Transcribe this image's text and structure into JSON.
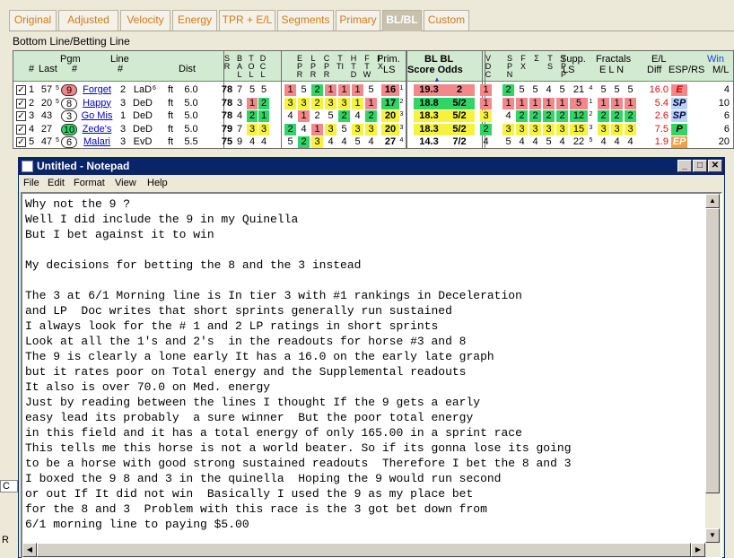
{
  "tabs": [
    "Original",
    "Adjusted",
    "Velocity",
    "Energy",
    "TPR + E/L",
    "Segments",
    "Primary",
    "BL/BL",
    "Custom"
  ],
  "section_title": "Bottom Line/Betting Line",
  "grid": {
    "headers": {
      "num": "#",
      "last": "Last",
      "pgm": "Pgm",
      "pgm_num": "#",
      "line": "Line",
      "line_num": "#",
      "dist": "Dist",
      "prim": "Prim.",
      "ls": "LS",
      "bl_bl": "BL BL",
      "score_odds": "Score Odds",
      "supp": "Supp.",
      "fractals": "Fractals",
      "eln": "E L N",
      "el": "E/L",
      "diff": "Diff",
      "esp": "ESP/RS",
      "win": "Win",
      "ml": "M/L",
      "vertical": [
        {
          "text": "SR"
        },
        {
          "text": "BAL"
        },
        {
          "text": "TOL"
        },
        {
          "text": "DCL"
        },
        {
          "text": "EPR"
        },
        {
          "text": "LPR"
        },
        {
          "text": "CPR"
        },
        {
          "text": "TTI"
        },
        {
          "text": "HTD"
        },
        {
          "text": "FTW"
        },
        {
          "text": "FX"
        },
        {
          "text": "VDC"
        },
        {
          "text": "SPN"
        },
        {
          "text": "FX"
        },
        {
          "text": "Σ"
        },
        {
          "text": "TS"
        },
        {
          "text": "TPP"
        }
      ]
    },
    "rows": [
      {
        "checked": "✓",
        "num": "1",
        "last": "57",
        "last_sup": "5",
        "pgm": "9",
        "name": "Forget",
        "line_num": "2",
        "line": "LaD",
        "line_sup": "6",
        "surf": "ft",
        "dist": "6.0",
        "sr": "78",
        "a": "7",
        "b": "5",
        "c": "5",
        "pr": [
          {
            "v": "1",
            "k": "r"
          },
          {
            "v": "5",
            "k": ""
          },
          {
            "v": "2",
            "k": "g"
          },
          {
            "v": "1",
            "k": "r"
          },
          {
            "v": "1",
            "k": "r"
          },
          {
            "v": "1",
            "k": "r"
          },
          {
            "v": "5",
            "k": ""
          }
        ],
        "prim": "16",
        "prim_sup": "1",
        "prim_k": "r",
        "score": "19.3",
        "odds": "2",
        "bl_k": "r",
        "vdc": "1",
        "vdc_k": "r",
        "sp": [
          {
            "v": "2",
            "k": "g"
          },
          {
            "v": "5",
            "k": ""
          },
          {
            "v": "5",
            "k": ""
          },
          {
            "v": "4",
            "k": ""
          },
          {
            "v": "5",
            "k": ""
          }
        ],
        "supp": "21",
        "supp_sup": "4",
        "supp_k": "",
        "fr": [
          {
            "v": "5",
            "k": ""
          },
          {
            "v": "5",
            "k": ""
          },
          {
            "v": "5",
            "k": ""
          }
        ],
        "diff": "16.0",
        "diff_color": "#e01010",
        "esp": "E",
        "esp_k": "espE",
        "ml": "4"
      },
      {
        "checked": "✓",
        "num": "2",
        "last": "20",
        "last_sup": "5",
        "pgm": "8",
        "name": "Happy",
        "line_num": "3",
        "line": "DeD",
        "line_sup": "",
        "surf": "ft",
        "dist": "5.0",
        "sr": "78",
        "a": "3",
        "b": "1",
        "c": "2",
        "bc_k": "b2",
        "pr": [
          {
            "v": "3",
            "k": "y"
          },
          {
            "v": "3",
            "k": "y"
          },
          {
            "v": "2",
            "k": "y"
          },
          {
            "v": "3",
            "k": "y"
          },
          {
            "v": "3",
            "k": "y"
          },
          {
            "v": "1",
            "k": "y"
          },
          {
            "v": "1",
            "k": "r"
          }
        ],
        "prim": "17",
        "prim_sup": "2",
        "prim_k": "g",
        "score": "18.8",
        "odds": "5/2",
        "bl_k": "g",
        "vdc": "1",
        "vdc_k": "r",
        "sp": [
          {
            "v": "1",
            "k": "r"
          },
          {
            "v": "1",
            "k": "r"
          },
          {
            "v": "1",
            "k": "r"
          },
          {
            "v": "1",
            "k": "r"
          },
          {
            "v": "1",
            "k": "r"
          }
        ],
        "supp": "5",
        "supp_sup": "1",
        "supp_k": "r",
        "fr": [
          {
            "v": "1",
            "k": "r"
          },
          {
            "v": "1",
            "k": "r"
          },
          {
            "v": "1",
            "k": "r"
          }
        ],
        "diff": "5.4",
        "diff_color": "#e01010",
        "esp": "SP",
        "esp_k": "espSP",
        "ml": "10"
      },
      {
        "checked": "✓",
        "num": "3",
        "last": "43",
        "last_sup": "",
        "pgm": "3",
        "name": "Go Mis",
        "line_num": "1",
        "line": "DeD",
        "line_sup": "",
        "surf": "ft",
        "dist": "5.0",
        "sr": "78",
        "a": "4",
        "b": "2",
        "c": "1",
        "bc_k": "g2",
        "pr": [
          {
            "v": "4",
            "k": ""
          },
          {
            "v": "1",
            "k": "r"
          },
          {
            "v": "2",
            "k": ""
          },
          {
            "v": "5",
            "k": ""
          },
          {
            "v": "2",
            "k": "g"
          },
          {
            "v": "4",
            "k": ""
          },
          {
            "v": "2",
            "k": "g"
          }
        ],
        "prim": "20",
        "prim_sup": "3",
        "prim_k": "y",
        "score": "18.3",
        "odds": "5/2",
        "bl_k": "y",
        "vdc": "3",
        "vdc_k": "y",
        "sp": [
          {
            "v": "4",
            "k": ""
          },
          {
            "v": "2",
            "k": "g"
          },
          {
            "v": "2",
            "k": "g"
          },
          {
            "v": "2",
            "k": "g"
          },
          {
            "v": "2",
            "k": "g"
          }
        ],
        "supp": "12",
        "supp_sup": "2",
        "supp_k": "g",
        "fr": [
          {
            "v": "2",
            "k": "g"
          },
          {
            "v": "2",
            "k": "g"
          },
          {
            "v": "2",
            "k": "g"
          }
        ],
        "diff": "2.6",
        "diff_color": "#e01010",
        "esp": "SP",
        "esp_k": "espSP",
        "ml": "6"
      },
      {
        "checked": "✓",
        "num": "4",
        "last": "27",
        "last_sup": "",
        "pgm": "10",
        "name": "Zede's",
        "line_num": "3",
        "line": "DeD",
        "line_sup": "",
        "surf": "ft",
        "dist": "5.0",
        "sr": "79",
        "a": "7",
        "b": "3",
        "c": "3",
        "bc_k": "y2",
        "pr": [
          {
            "v": "2",
            "k": "g"
          },
          {
            "v": "4",
            "k": ""
          },
          {
            "v": "1",
            "k": "r"
          },
          {
            "v": "3",
            "k": "y"
          },
          {
            "v": "5",
            "k": ""
          },
          {
            "v": "3",
            "k": "y"
          },
          {
            "v": "3",
            "k": "y"
          }
        ],
        "prim": "20",
        "prim_sup": "3",
        "prim_k": "y",
        "score": "18.3",
        "odds": "5/2",
        "bl_k": "y",
        "vdc": "2",
        "vdc_k": "g",
        "sp": [
          {
            "v": "3",
            "k": "y"
          },
          {
            "v": "3",
            "k": "y"
          },
          {
            "v": "3",
            "k": "y"
          },
          {
            "v": "3",
            "k": "y"
          },
          {
            "v": "3",
            "k": "y"
          }
        ],
        "supp": "15",
        "supp_sup": "3",
        "supp_k": "y",
        "fr": [
          {
            "v": "3",
            "k": "y"
          },
          {
            "v": "3",
            "k": "y"
          },
          {
            "v": "3",
            "k": "y"
          }
        ],
        "diff": "7.5",
        "diff_color": "#e01010",
        "esp": "P",
        "esp_k": "espP",
        "ml": "6"
      },
      {
        "checked": "✓",
        "num": "5",
        "last": "47",
        "last_sup": "5",
        "pgm": "6",
        "name": "Malari",
        "line_num": "3",
        "line": "EvD",
        "line_sup": "",
        "surf": "ft",
        "dist": "5.5",
        "sr": "75",
        "a": "9",
        "b": "4",
        "c": "4",
        "pr": [
          {
            "v": "5",
            "k": ""
          },
          {
            "v": "2",
            "k": "g"
          },
          {
            "v": "3",
            "k": "y"
          },
          {
            "v": "4",
            "k": ""
          },
          {
            "v": "4",
            "k": ""
          },
          {
            "v": "5",
            "k": ""
          },
          {
            "v": "4",
            "k": ""
          }
        ],
        "prim": "27",
        "prim_sup": "4",
        "prim_k": "",
        "score": "14.3",
        "odds": "7/2",
        "bl_k": "",
        "vdc": "4",
        "vdc_k": "",
        "sp": [
          {
            "v": "5",
            "k": ""
          },
          {
            "v": "4",
            "k": ""
          },
          {
            "v": "4",
            "k": ""
          },
          {
            "v": "5",
            "k": ""
          },
          {
            "v": "4",
            "k": ""
          }
        ],
        "supp": "22",
        "supp_sup": "5",
        "supp_k": "",
        "fr": [
          {
            "v": "4",
            "k": ""
          },
          {
            "v": "4",
            "k": ""
          },
          {
            "v": "4",
            "k": ""
          }
        ],
        "diff": "1.9",
        "diff_color": "#e01010",
        "esp": "EP",
        "esp_k": "espEP",
        "ml": "20"
      }
    ]
  },
  "background": {
    "left_c": "C",
    "left_r": "R"
  },
  "notepad": {
    "title": "Untitled - Notepad",
    "menu": [
      "File",
      "Edit",
      "Format",
      "View",
      "Help"
    ],
    "lines": [
      "Why not the 9 ?",
      "Well I did include the 9 in my Quinella",
      "But I bet against it to win",
      "",
      "My decisions for betting the 8 and the 3 instead",
      "",
      "The 3 at 6/1 Morning line is In tier 3 with #1 rankings in Deceleration",
      "and LP  Doc writes that short sprints generally run sustained",
      "I always look for the # 1 and 2 LP ratings in short sprints",
      "Look at all the 1's and 2's  in the readouts for horse #3 and 8",
      "The 9 is clearly a lone early It has a 16.0 on the early late graph",
      "but it rates poor on Total energy and the Supplemental readouts",
      "It also is over 70.0 on Med. energy",
      "Just by reading between the lines I thought If the 9 gets a early",
      "easy lead its probably  a sure winner  But the poor total energy",
      "in this field and it has a total energy of only 165.00 in a sprint race",
      "This tells me this horse is not a world beater. So if its gonna lose its going",
      "to be a horse with good strong sustained readouts  Therefore I bet the 8 and 3",
      "I boxed the 9 8 and 3 in the quinella  Hoping the 9 would run second",
      "or out If It did not win  Basically I used the 9 as my place bet",
      "for the 8 and 3  Problem with this race is the 3 got bet down from",
      "6/1 morning line to paying $5.00"
    ]
  }
}
